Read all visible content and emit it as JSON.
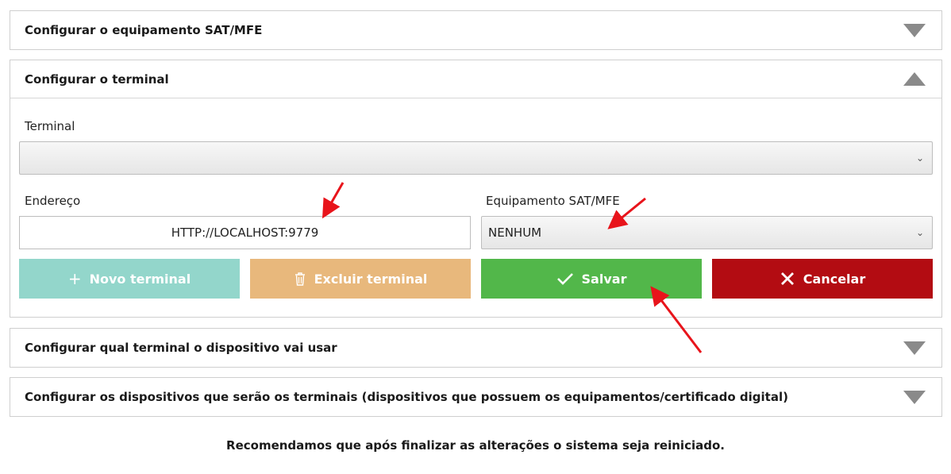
{
  "panels": {
    "sat": {
      "title": "Configurar o equipamento SAT/MFE"
    },
    "terminal": {
      "title": "Configurar o terminal"
    },
    "device_terminal": {
      "title": "Configurar qual terminal o dispositivo vai usar"
    },
    "devices": {
      "title": "Configurar os dispositivos que serão os terminais (dispositivos que possuem os equipamentos/certificado digital)"
    }
  },
  "form": {
    "terminal_label": "Terminal",
    "terminal_value": "",
    "address_label": "Endereço",
    "address_value": "HTTP://LOCALHOST:9779",
    "equipment_label": "Equipamento SAT/MFE",
    "equipment_value": "NENHUM"
  },
  "buttons": {
    "new_terminal": "Novo terminal",
    "delete_terminal": "Excluir terminal",
    "save": "Salvar",
    "cancel": "Cancelar"
  },
  "colors": {
    "new_terminal": "#93d6cb",
    "delete_terminal": "#e8b87c",
    "save": "#52b74a",
    "cancel": "#b30c12",
    "annotation_arrow": "#e8141b"
  },
  "footer": {
    "note": "Recomendamos que após finalizar as alterações o sistema seja reiniciado."
  }
}
